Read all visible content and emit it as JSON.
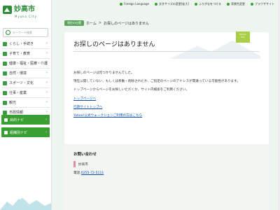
{
  "sidebar": {
    "logo_text": "妙高市",
    "logo_sub": "Myoko City",
    "search_placeholder": "キーワード検索",
    "nav": [
      {
        "label": "くらし・手続き"
      },
      {
        "label": "子育て・教育"
      },
      {
        "label": "健康・福祉・医療・介護"
      },
      {
        "label": "自然・環境"
      },
      {
        "label": "スポーツ・文化"
      },
      {
        "label": "仕事・産業"
      },
      {
        "label": "観光"
      },
      {
        "label": "市政情報"
      }
    ],
    "buttons": [
      {
        "label": "目的ナビ"
      },
      {
        "label": "組織別ナビ"
      }
    ]
  },
  "topbar": {
    "foreign": "Foreign Language",
    "font_size": "文字サイズの変更[拡大]",
    "ruby": "ふりがなをつける",
    "color": "背景色変更",
    "browser": "ブラウザサイト"
  },
  "breadcrumb": {
    "badge": "現在の位置",
    "home": "ホーム",
    "sep": ">",
    "current": "お探しのページはありません"
  },
  "main": {
    "flag_line1": "Myoko",
    "flag_line2": "City",
    "title": "お探しのページはありません",
    "p1": "お探しのページは見つかりませんでした。",
    "p2": "現在公開していない、もしくは移動・削除されたか、ご指定のページのアドレスが間違っている可能性があります。",
    "p3": "トップページからページをお探しいただくか、サイト内検索をご利用ください。",
    "link1": "トップページへ",
    "link2": "行政サイトトップへ",
    "link3": "Yahoo!公式ウォークションご利用の方はこちら"
  },
  "contact": {
    "heading": "お問い合わせ",
    "org": "妙高市",
    "tel_label": "電話",
    "tel": "0255-72-5111"
  },
  "colors": {
    "brand_green": "#3a9f33",
    "link_blue": "#0b4cb0",
    "accent_pink": "#e48aa8"
  }
}
